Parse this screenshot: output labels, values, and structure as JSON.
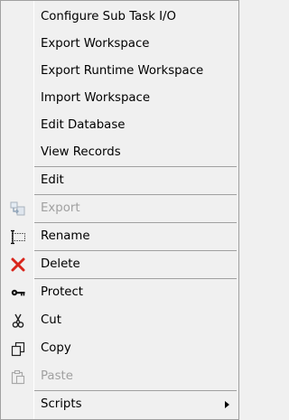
{
  "menu": {
    "items": [
      {
        "label": "Configure Sub Task I/O",
        "icon": "none"
      },
      {
        "label": "Export Workspace",
        "icon": "none"
      },
      {
        "label": "Export Runtime Workspace",
        "icon": "none"
      },
      {
        "label": "Import Workspace",
        "icon": "none"
      },
      {
        "label": "Edit Database",
        "icon": "none"
      },
      {
        "label": "View Records",
        "icon": "none"
      },
      {
        "label": "Edit",
        "icon": "none"
      },
      {
        "label": "Export",
        "icon": "export-icon",
        "disabled": true
      },
      {
        "label": "Rename",
        "icon": "rename-icon"
      },
      {
        "label": "Delete",
        "icon": "delete-icon"
      },
      {
        "label": "Protect",
        "icon": "key-icon"
      },
      {
        "label": "Cut",
        "icon": "scissors-icon"
      },
      {
        "label": "Copy",
        "icon": "copy-icon"
      },
      {
        "label": "Paste",
        "icon": "paste-icon",
        "disabled": true
      },
      {
        "label": "Scripts",
        "icon": "none",
        "submenu": true
      }
    ]
  },
  "colors": {
    "background": "#f0f0f0",
    "separator": "#a0a0a0",
    "disabled_text": "#a0a0a0",
    "delete_icon": "#d9261c"
  }
}
